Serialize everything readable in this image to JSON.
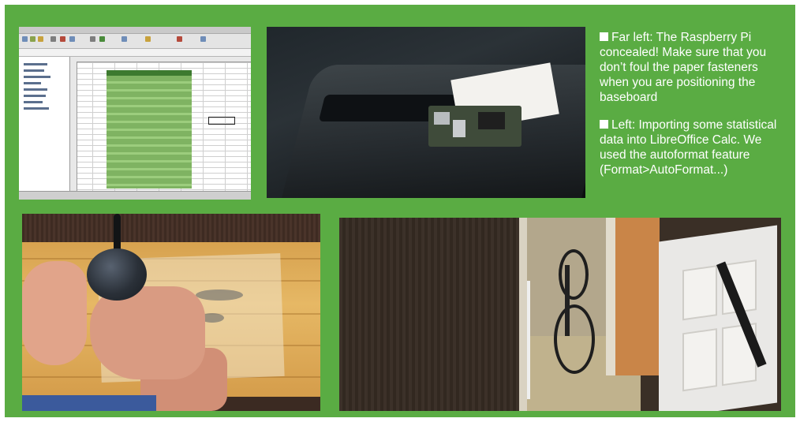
{
  "captions": [
    {
      "marker": "square-bullet",
      "text": "Far left: The Raspberry Pi concealed! Make sure that you don’t foul the paper fasteners when you are positioning the baseboard"
    },
    {
      "marker": "square-bullet",
      "text": "Left: Importing some statistical data into LibreOffice Calc. We used the autoformat feature (Format>AutoFormat...)"
    }
  ],
  "colors": {
    "panel_green": "#5aac43",
    "caption_text": "#ffffff"
  },
  "photos": [
    {
      "subject": "LibreOffice Calc spreadsheet screenshot with green autoformatted table"
    },
    {
      "subject": "Raspberry Pi concealed under a dark projector/base housing"
    },
    {
      "subject": "Hand holding a round sensor over paper on a wooden board"
    },
    {
      "subject": "Hallway view with bicycle and open door"
    }
  ]
}
